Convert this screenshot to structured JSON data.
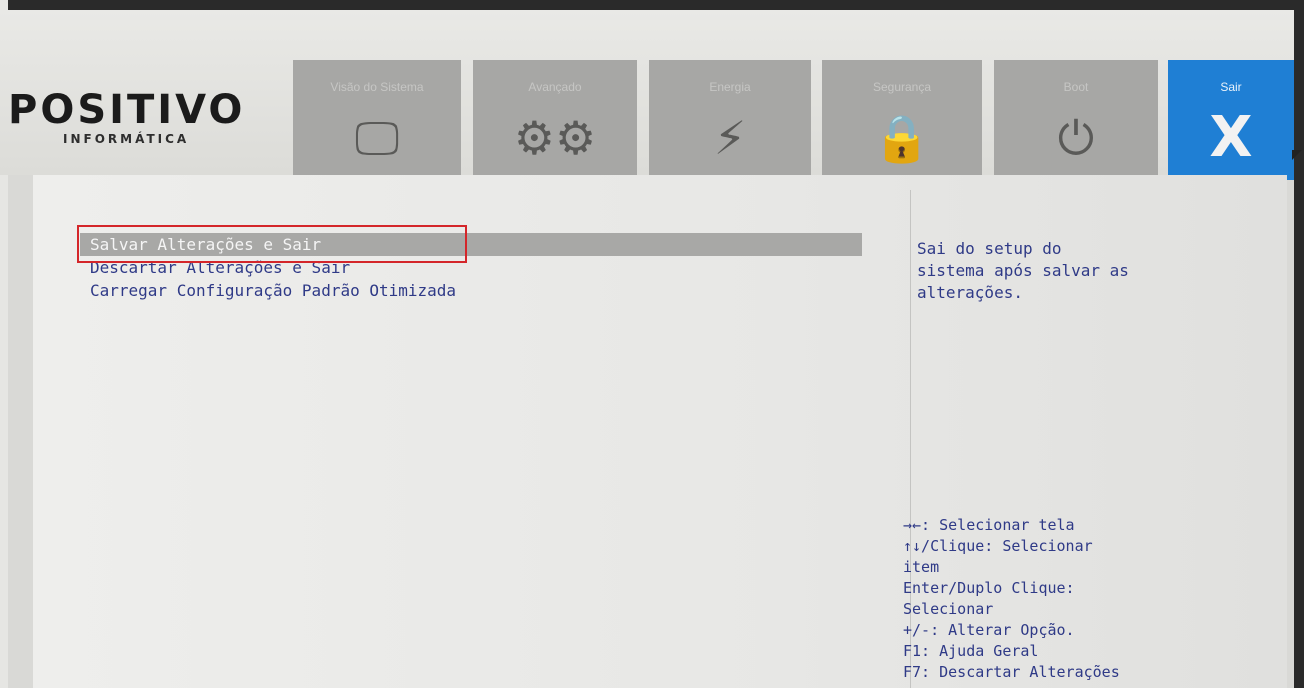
{
  "logo": {
    "main": "POSITIVO",
    "sub": "INFORMÁTICA"
  },
  "tabs": [
    {
      "label": "Visão do Sistema",
      "icon": "monitor-icon",
      "glyph": "🖵"
    },
    {
      "label": "Avançado",
      "icon": "gears-icon",
      "glyph": "⚙⚙"
    },
    {
      "label": "Energia",
      "icon": "lightning-icon",
      "glyph": "⚡"
    },
    {
      "label": "Segurança",
      "icon": "lock-icon",
      "glyph": "🔒"
    },
    {
      "label": "Boot",
      "icon": "power-icon",
      "glyph": "⏻"
    },
    {
      "label": "Sair",
      "icon": "close-icon",
      "glyph": "X",
      "active": true
    }
  ],
  "menu": {
    "items": [
      {
        "label": "Salvar Alterações e Sair",
        "selected": true
      },
      {
        "label": "Descartar Alterações e Sair"
      },
      {
        "label": "Carregar Configuração Padrão Otimizada"
      }
    ]
  },
  "help": {
    "text": [
      "Sai do setup do",
      "sistema após salvar as",
      "alterações."
    ]
  },
  "keys": [
    "→←: Selecionar tela",
    "↑↓/Clique: Selecionar",
    "item",
    "Enter/Duplo Clique:",
    "Selecionar",
    "+/-: Alterar Opção.",
    "F1: Ajuda Geral",
    "F7: Descartar Alterações"
  ],
  "colors": {
    "accent": "#1f7fd4",
    "tab_bg": "#a7a7a5",
    "menu_text": "#2f3a87",
    "selected_bg": "#a8a8a6",
    "annotation": "#d4262a"
  }
}
